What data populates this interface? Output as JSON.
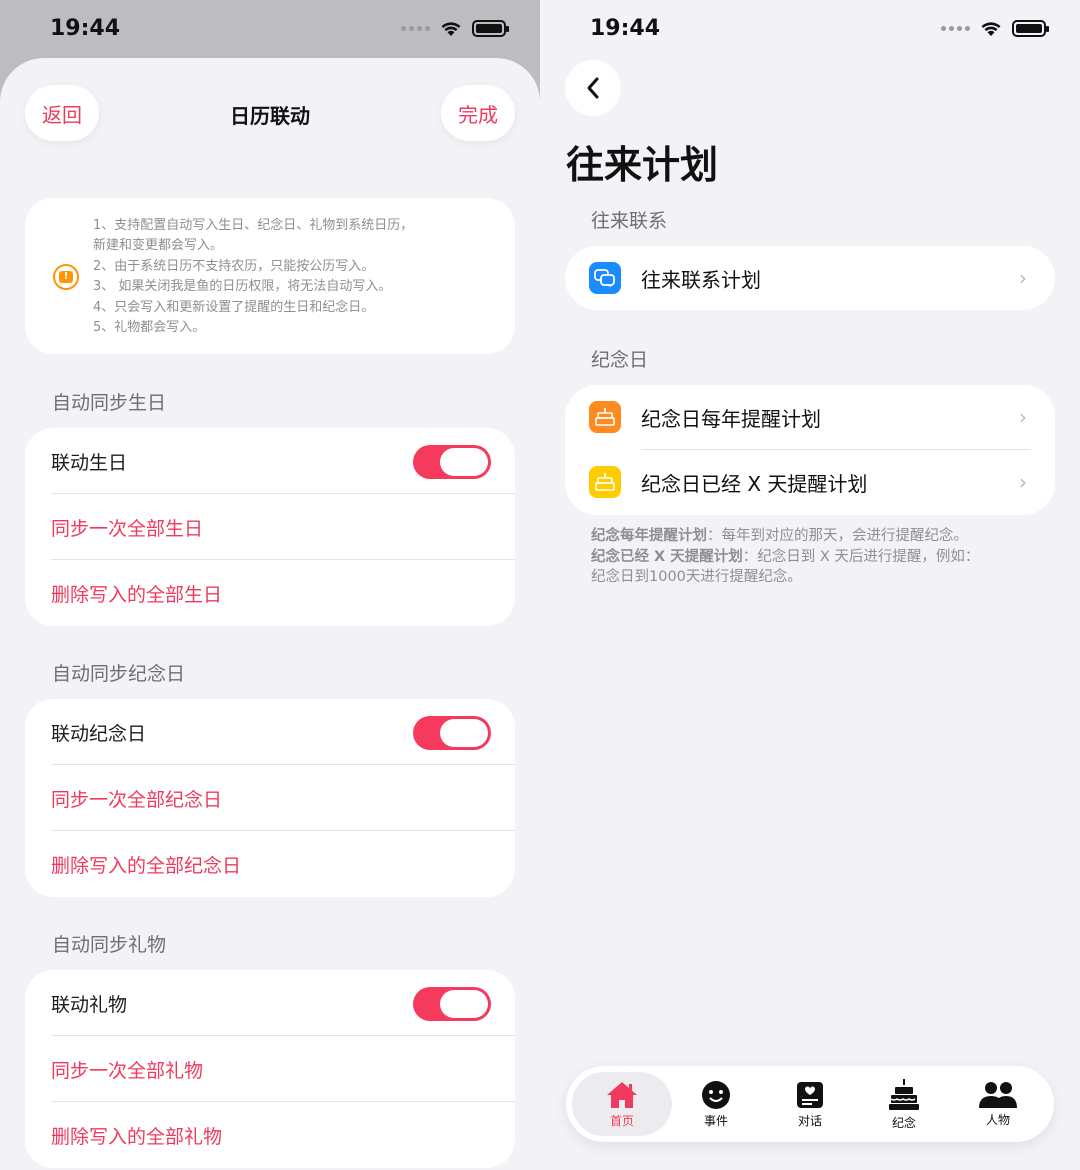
{
  "status": {
    "time": "19:44"
  },
  "left": {
    "nav": {
      "back": "返回",
      "title": "日历联动",
      "done": "完成"
    },
    "notes": [
      "1、支持配置自动写入生日、纪念日、礼物到系统日历，",
      "新建和变更都会写入。",
      "2、由于系统日历不支持农历，只能按公历写入。",
      "3、 如果关闭我是鱼的日历权限，将无法自动写入。",
      "4、只会写入和更新设置了提醒的生日和纪念日。",
      "5、礼物都会写入。"
    ],
    "sections": [
      {
        "header": "自动同步生日",
        "toggle_label": "联动生日",
        "toggle_on": true,
        "sync": "同步一次全部生日",
        "delete": "删除写入的全部生日"
      },
      {
        "header": "自动同步纪念日",
        "toggle_label": "联动纪念日",
        "toggle_on": true,
        "sync": "同步一次全部纪念日",
        "delete": "删除写入的全部纪念日"
      },
      {
        "header": "自动同步礼物",
        "toggle_label": "联动礼物",
        "toggle_on": true,
        "sync": "同步一次全部礼物",
        "delete": "删除写入的全部礼物"
      }
    ]
  },
  "right": {
    "title": "往来计划",
    "contacts_section": {
      "header": "往来联系",
      "items": [
        {
          "label": "往来联系计划",
          "icon": "chat-bubbles-icon"
        }
      ]
    },
    "anniversary_section": {
      "header": "纪念日",
      "items": [
        {
          "label": "纪念日每年提醒计划",
          "icon": "cake-icon"
        },
        {
          "label": "纪念日已经 X 天提醒计划",
          "icon": "cake-icon"
        }
      ]
    },
    "note": {
      "line1_bold": "纪念每年提醒计划",
      "line1_rest": "：每年到对应的那天，会进行提醒纪念。",
      "line2_bold": "纪念已经 X 天提醒计划",
      "line2_rest": "：纪念日到 X 天后进行提醒，例如：",
      "line3": "纪念日到1000天进行提醒纪念。"
    },
    "tabs": [
      {
        "label": "首页",
        "icon": "home-icon",
        "active": true
      },
      {
        "label": "事件",
        "icon": "theater-masks-icon",
        "active": false
      },
      {
        "label": "对话",
        "icon": "message-card-icon",
        "active": false
      },
      {
        "label": "纪念",
        "icon": "cake-icon",
        "active": false
      },
      {
        "label": "人物",
        "icon": "people-icon",
        "active": false
      }
    ]
  },
  "colors": {
    "accent": "#ef3a5d",
    "toggle": "#f53a5e",
    "orange": "#ff9500",
    "blue": "#1a8cff",
    "yellow": "#ffcc00"
  }
}
